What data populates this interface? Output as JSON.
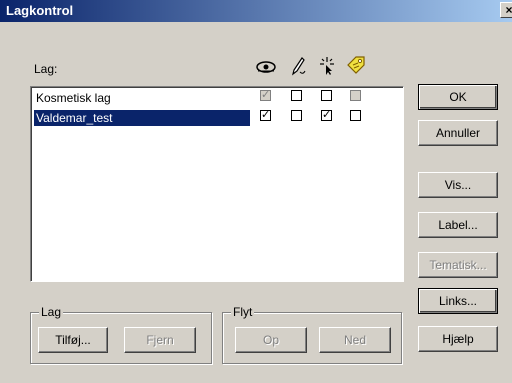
{
  "window": {
    "title": "Lagkontrol",
    "close_label": "×"
  },
  "list": {
    "header_label": "Lag:",
    "columns": [
      {
        "icon": "eye-icon"
      },
      {
        "icon": "pencil-icon"
      },
      {
        "icon": "cursor-icon"
      },
      {
        "icon": "tag-icon"
      }
    ],
    "rows": [
      {
        "name": "Kosmetisk lag",
        "selected": false,
        "visible": true,
        "editable": false,
        "selectable": false,
        "label": false
      },
      {
        "name": "Valdemar_test",
        "selected": true,
        "visible": true,
        "editable": false,
        "selectable": true,
        "label": false
      }
    ]
  },
  "buttons": {
    "ok": "OK",
    "cancel": "Annuller",
    "display": "Vis...",
    "label": "Label...",
    "thematic": "Tematisk...",
    "links": "Links...",
    "help": "Hjælp"
  },
  "groups": {
    "layer": {
      "legend": "Lag",
      "add": "Tilføj...",
      "remove": "Fjern"
    },
    "move": {
      "legend": "Flyt",
      "up": "Op",
      "down": "Ned"
    }
  }
}
